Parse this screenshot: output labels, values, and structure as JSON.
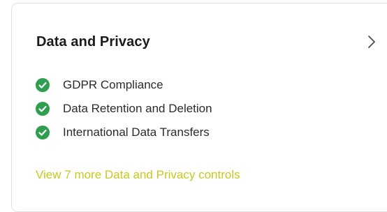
{
  "card": {
    "title": "Data and Privacy",
    "chevron_icon": "chevron-right-icon",
    "controls": [
      {
        "label": "GDPR Compliance",
        "status": "passed",
        "icon": "check-circle-icon"
      },
      {
        "label": "Data Retention and Deletion",
        "status": "passed",
        "icon": "check-circle-icon"
      },
      {
        "label": "International Data Transfers",
        "status": "passed",
        "icon": "check-circle-icon"
      }
    ],
    "more_link": "View 7 more Data and Privacy controls"
  },
  "colors": {
    "check": "#2e9e4f",
    "link": "#c8c81e",
    "title": "#1a1a1a",
    "text": "#2b2b2b",
    "border": "#e2e2e2"
  }
}
